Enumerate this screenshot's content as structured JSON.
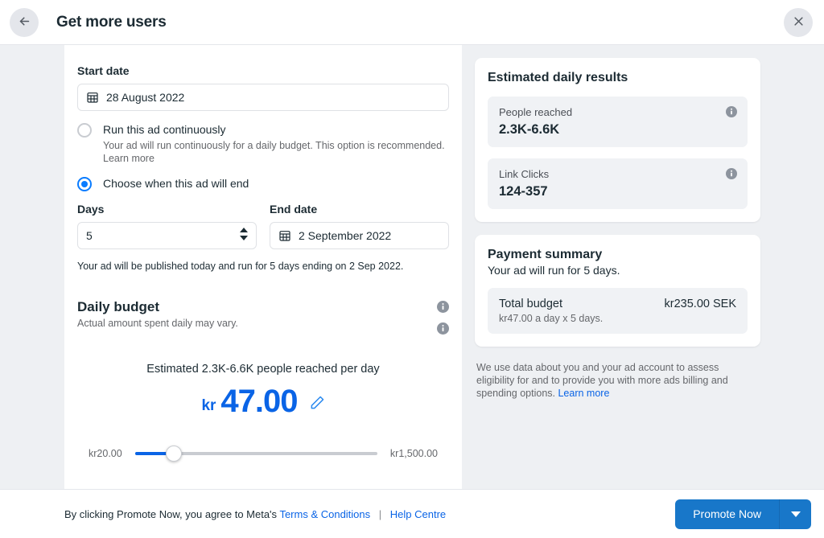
{
  "header": {
    "title": "Get more users",
    "back_icon": "arrow-left-icon",
    "close_icon": "close-icon"
  },
  "schedule": {
    "start_date_label": "Start date",
    "start_date_value": "28 August 2022",
    "option_continuous": {
      "title": "Run this ad continuously",
      "desc": "Your ad will run continuously for a daily budget. This option is recommended.",
      "learn_more": "Learn more",
      "selected": false
    },
    "option_end": {
      "title": "Choose when this ad will end",
      "selected": true
    },
    "days_label": "Days",
    "days_value": "5",
    "end_date_label": "End date",
    "end_date_value": "2 September 2022",
    "note": "Your ad will be published today and run for 5 days ending on 2 Sep 2022."
  },
  "budget": {
    "title": "Daily budget",
    "subtitle": "Actual amount spent daily may vary.",
    "estimate_line": "Estimated 2.3K-6.6K people reached per day",
    "currency": "kr",
    "amount": "47.00",
    "edit_icon": "pencil-icon",
    "slider_min": "kr20.00",
    "slider_max": "kr1,500.00",
    "slider_percent": 16
  },
  "results": {
    "title": "Estimated daily results",
    "stats": [
      {
        "label": "People reached",
        "value": "2.3K-6.6K"
      },
      {
        "label": "Link Clicks",
        "value": "124-357"
      }
    ]
  },
  "payment": {
    "title": "Payment summary",
    "subtitle": "Your ad will run for 5 days.",
    "total_label": "Total budget",
    "total_sub": "kr47.00 a day x 5 days.",
    "total_amount": "kr235.00 SEK"
  },
  "disclaimer": {
    "text": "We use data about you and your ad account to assess eligibility for and to provide you with more ads billing and spending options.",
    "link": "Learn more"
  },
  "footer": {
    "text": "By clicking Promote Now, you agree to Meta's",
    "terms": "Terms & Conditions",
    "separator": "|",
    "help": "Help Centre",
    "promote_label": "Promote Now",
    "caret_icon": "chevron-down-icon"
  },
  "colors": {
    "accent": "#0a64e6",
    "button": "#1877c9",
    "page_bg": "#eef0f3"
  }
}
